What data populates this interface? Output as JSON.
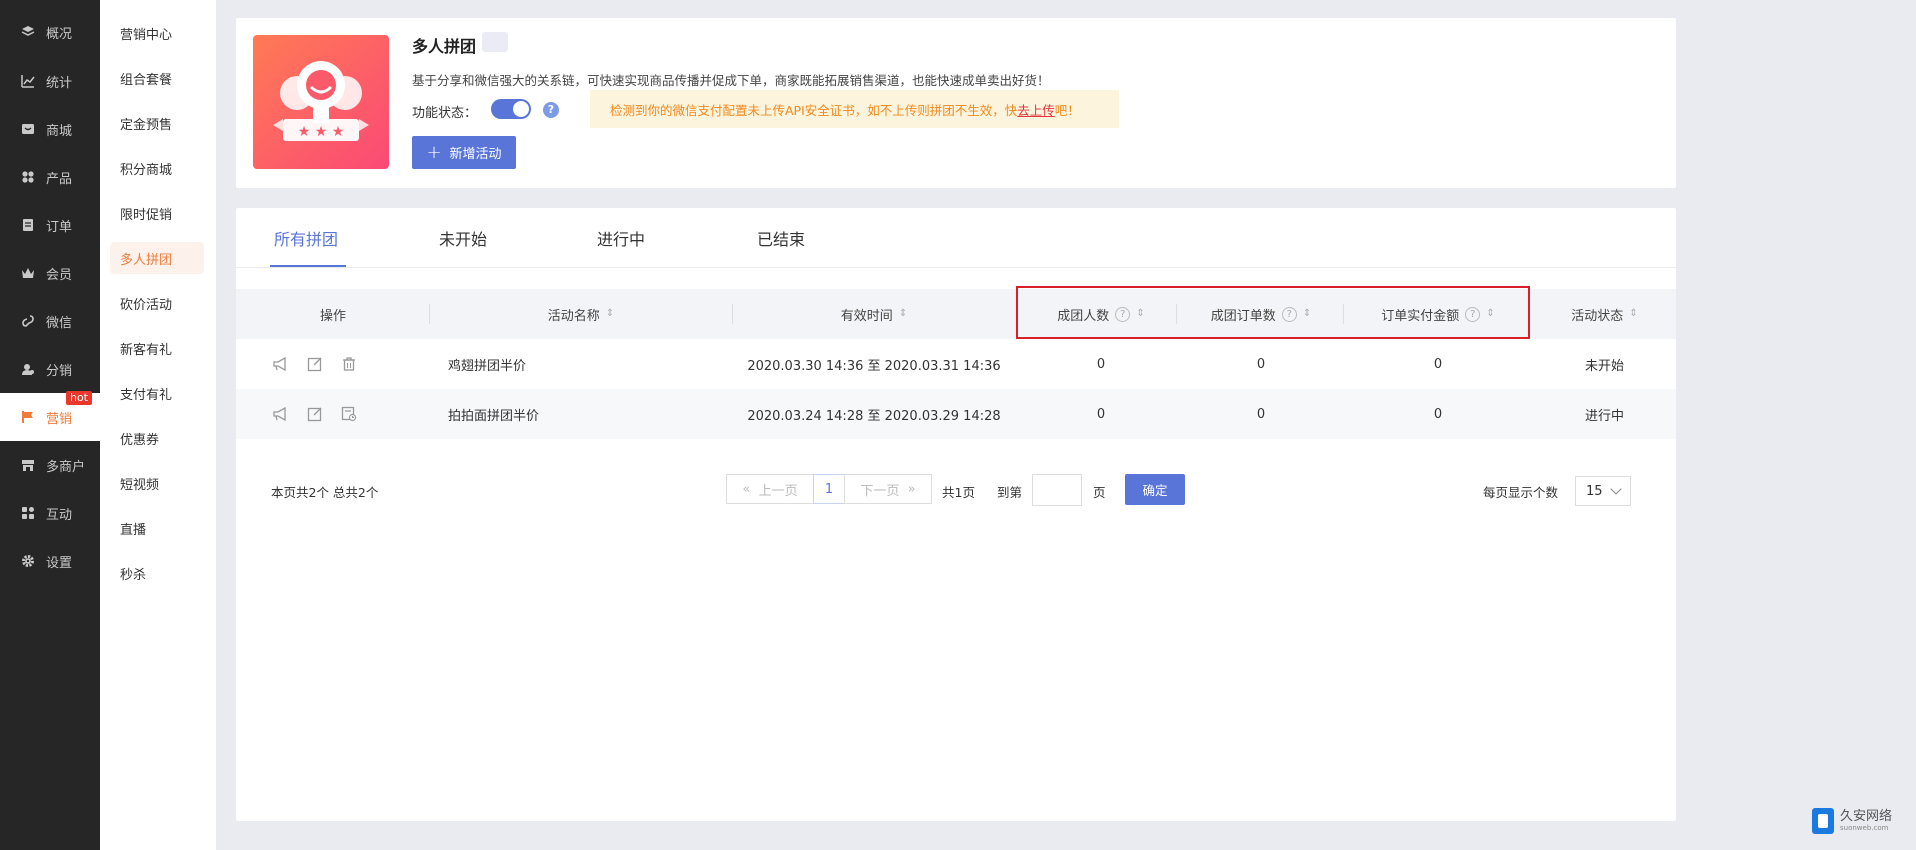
{
  "nav": {
    "items": [
      {
        "label": "概况",
        "icon": "layers-icon"
      },
      {
        "label": "统计",
        "icon": "chart-icon"
      },
      {
        "label": "商城",
        "icon": "store-icon"
      },
      {
        "label": "产品",
        "icon": "grid-icon"
      },
      {
        "label": "订单",
        "icon": "order-icon"
      },
      {
        "label": "会员",
        "icon": "crown-icon"
      },
      {
        "label": "微信",
        "icon": "wechat-icon"
      },
      {
        "label": "分销",
        "icon": "distribution-icon"
      },
      {
        "label": "营销",
        "icon": "flag-icon",
        "badge": "hot"
      },
      {
        "label": "多商户",
        "icon": "shop-icon"
      },
      {
        "label": "互动",
        "icon": "interact-icon"
      },
      {
        "label": "设置",
        "icon": "gear-icon"
      }
    ]
  },
  "subnav": {
    "items": [
      "营销中心",
      "组合套餐",
      "定金预售",
      "积分商城",
      "限时促销",
      "多人拼团",
      "砍价活动",
      "新客有礼",
      "支付有礼",
      "优惠券",
      "短视频",
      "直播",
      "秒杀"
    ]
  },
  "header": {
    "title": "多人拼团",
    "description": "基于分享和微信强大的关系链，可快速实现商品传播并促成下单，商家既能拓展销售渠道，也能快速成单卖出好货！",
    "status_label": "功能状态：",
    "help": "?",
    "warning_prefix": "检测到你的微信支付配置未上传API安全证书，如不上传则拼团不生效，快",
    "warning_link": "去上传",
    "warning_suffix": "吧！",
    "new_button": "新增活动",
    "new_button_icon": "+"
  },
  "tabs": [
    "所有拼团",
    "未开始",
    "进行中",
    "已结束"
  ],
  "table": {
    "headers": {
      "op": "操作",
      "name": "活动名称",
      "time": "有效时间",
      "group_people": "成团人数",
      "group_orders": "成团订单数",
      "paid_amount": "订单实付金额",
      "status": "活动状态"
    },
    "rows": [
      {
        "name": "鸡翅拼团半价",
        "time": "2020.03.30 14:36 至 2020.03.31 14:36",
        "group_people": "0",
        "group_orders": "0",
        "paid_amount": "0",
        "status": "未开始"
      },
      {
        "name": "拍拍面拼团半价",
        "time": "2020.03.24 14:28 至 2020.03.29 14:28",
        "group_people": "0",
        "group_orders": "0",
        "paid_amount": "0",
        "status": "进行中"
      }
    ]
  },
  "pager": {
    "info": "本页共2个  总共2个",
    "prev": "上一页",
    "page": "1",
    "next": "下一页",
    "total_pages": "共1页",
    "goto": "到第",
    "page_unit": "页",
    "confirm": "确定",
    "per_page_label": "每页显示个数",
    "per_page": "15"
  },
  "watermark": {
    "name": "久安网络",
    "sub": "suonweb.com"
  },
  "colors": {
    "accent": "#5a75d8",
    "active_nav": "#f07c3b",
    "warning": "#f08a1e",
    "highlight_box": "#d8202a"
  }
}
